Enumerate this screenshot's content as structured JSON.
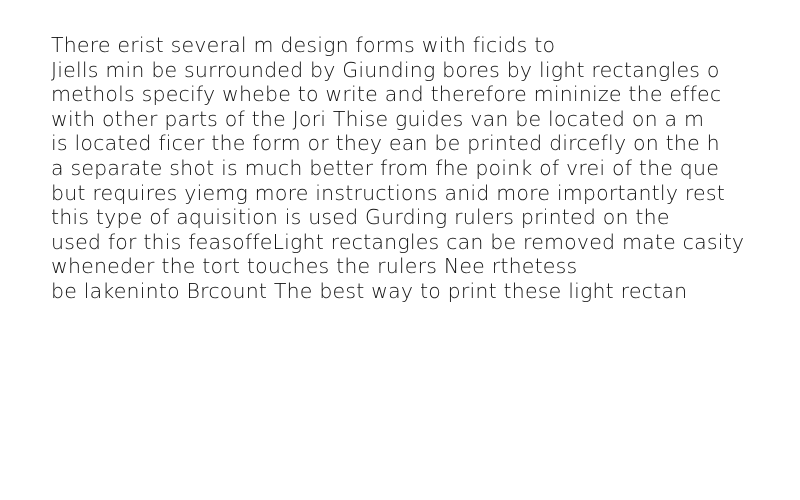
{
  "document": {
    "lines": [
      "There erist several m design forms with ficids to",
      "Jiells min be surrounded by Giunding bores by light rectangles o",
      "methols specify whebe to write and therefore mininize the effec",
      "with other parts of the Jori Thise guides van be located on a m",
      "is located ficer the form or they ean be printed dircefly on the h",
      "a separate shot is much better from fhe poink of vrei of the que",
      "but requires yiemg more instructions anid more importantly rest",
      "this type of aquisition is used Gurding rulers printed on the",
      "used for this feasoffeLight rectangles can be removed mate casity",
      "wheneder the tort touches the rulers Nee rthetess",
      "be lakeninto Brcount The best way to print these light rectan"
    ]
  }
}
